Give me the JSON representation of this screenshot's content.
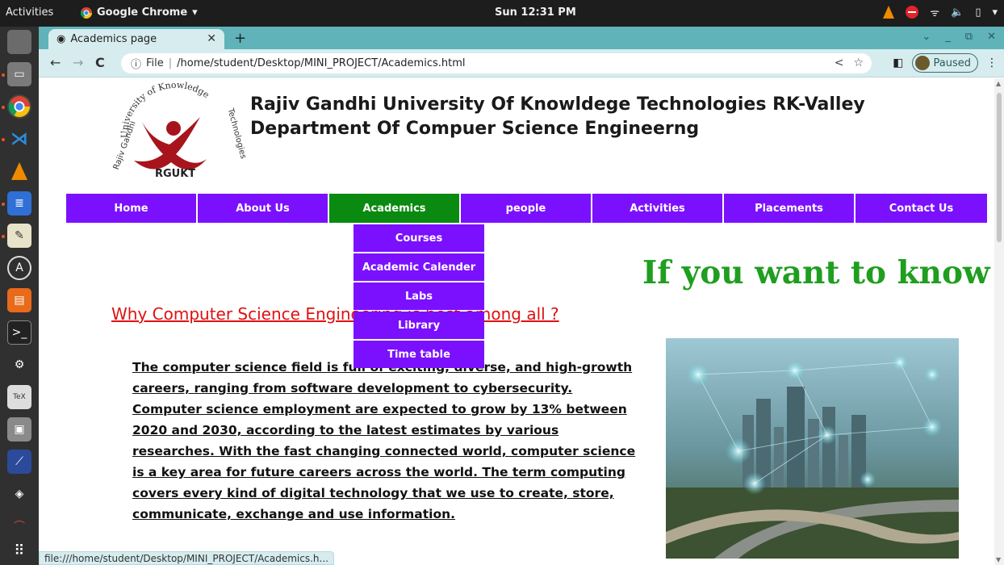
{
  "system": {
    "activities": "Activities",
    "app_name": "Google Chrome",
    "clock": "Sun 12:31 PM"
  },
  "browser": {
    "tab_title": "Academics page",
    "omnibox_scheme": "File",
    "url": "/home/student/Desktop/MINI_PROJECT/Academics.html",
    "profile_status": "Paused",
    "status_link": "file:///home/student/Desktop/MINI_PROJECT/Academics.h..."
  },
  "page": {
    "logo_text_top": "University of Knowledge",
    "logo_text_left": "Rajiv Gandhi",
    "logo_text_right": "Technologies",
    "logo_caption": "RGUKT",
    "title_line1": "Rajiv Gandhi University Of Knowldege Technologies RK-Valley",
    "title_line2": "Department Of Compuer Science Engineerng",
    "nav": [
      {
        "label": "Home"
      },
      {
        "label": "About Us"
      },
      {
        "label": "Academics"
      },
      {
        "label": "people"
      },
      {
        "label": "Activities"
      },
      {
        "label": "Placements"
      },
      {
        "label": "Contact Us"
      }
    ],
    "dropdown": [
      {
        "label": "Courses"
      },
      {
        "label": "Academic Calender"
      },
      {
        "label": "Labs"
      },
      {
        "label": "Library"
      },
      {
        "label": "Time table"
      }
    ],
    "promo_text": "If you want to know mo",
    "why_heading": "Why Computer Science Engineering is best among all ?",
    "paragraph": "The computer science field is full of exciting, diverse, and high-growth careers, ranging from software development to cybersecurity. Computer science employment are expected to grow by 13% between 2020 and 2030, according to the latest estimates by various researches. With the fast changing connected world, computer science is a key area for future careers across the world. The term computing covers every kind of digital technology that we use to create, store, communicate, exchange and use information."
  },
  "colors": {
    "nav_bg": "#7b10ff",
    "nav_active": "#0a8a10",
    "heading_red": "#e01010",
    "promo_green": "#1f9e1f",
    "logo_red": "#a8141c"
  }
}
